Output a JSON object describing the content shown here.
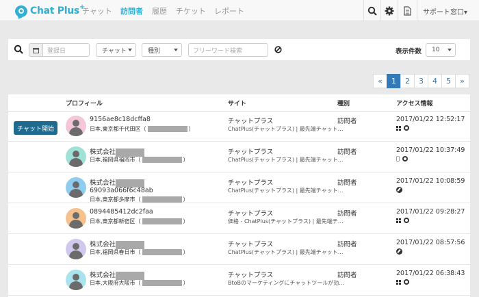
{
  "nav": {
    "logo_text": "Chat Plus",
    "logo_plus": "+",
    "menu": [
      {
        "label": "チャット",
        "active": false
      },
      {
        "label": "訪問者",
        "active": true
      },
      {
        "label": "履歴",
        "active": false
      },
      {
        "label": "チケット",
        "active": false
      },
      {
        "label": "レポート",
        "active": false
      }
    ],
    "user_menu": "サポート窓口▾"
  },
  "toolbar": {
    "date_placeholder": "登録日",
    "channel_select": "チャット",
    "type_select": "種別",
    "keyword_placeholder": "フリーワード検索",
    "page_size_label": "表示件数",
    "page_size_value": "10"
  },
  "pagination": {
    "pages": [
      "«",
      "1",
      "2",
      "3",
      "4",
      "5",
      "»"
    ],
    "active": "1"
  },
  "table": {
    "headers": {
      "profile": "プロフィール",
      "site": "サイト",
      "type": "種別",
      "access": "アクセス情報"
    },
    "chat_button": "チャット開始",
    "rows": [
      {
        "name": "9156ae8c18dcffa8",
        "name_masked": false,
        "extra": "",
        "location": "日本,東京都千代田区（",
        "location_end": "）",
        "site": "チャットプラス",
        "url": "ChatPlus(チャットプラス) | 最先端チャット…",
        "type": "訪問者",
        "date": "2017/01/22 12:52:17",
        "icons": [
          "windows",
          "chrome"
        ],
        "avatar_bg": "#f4c6d8"
      },
      {
        "name": "株式会社",
        "name_masked": true,
        "extra": "",
        "location": "日本,福岡県福岡市（",
        "location_end": "）",
        "site": "チャットプラス",
        "url": "ChatPlus(チャットプラス) | 最先端チャット…",
        "type": "訪問者",
        "date": "2017/01/22 10:37:49",
        "icons": [
          "apple",
          "chrome"
        ],
        "avatar_bg": "#9fe3d6"
      },
      {
        "name": "株式会社",
        "name_masked": true,
        "extra": "69093a066f6c48ab",
        "location": "日本,東京都多摩市（",
        "location_end": "）",
        "site": "チャットプラス",
        "url": "ChatPlus(チャットプラス) | 最先端チャット…",
        "type": "訪問者",
        "date": "2017/01/22 10:08:59",
        "icons": [
          "safari"
        ],
        "avatar_bg": "#8fcdf0"
      },
      {
        "name": "0894485412dc2faa",
        "name_masked": false,
        "extra": "",
        "location": "日本,東京都新宿区（",
        "location_end": "）",
        "site": "チャットプラス",
        "url": "価格 - ChatPlus(チャットプラス) | 最先端チ…",
        "type": "訪問者",
        "date": "2017/01/22 09:28:27",
        "icons": [
          "windows",
          "chrome"
        ],
        "avatar_bg": "#f6c18d"
      },
      {
        "name": "株式会社",
        "name_masked": true,
        "extra": "",
        "location": "日本,福岡県春日市（",
        "location_end": "）",
        "site": "チャットプラス",
        "url": "ChatPlus(チャットプラス) | 最先端チャット…",
        "type": "訪問者",
        "date": "2017/01/22 08:57:56",
        "icons": [
          "safari"
        ],
        "avatar_bg": "#d2c8ee"
      },
      {
        "name": "株式会社",
        "name_masked": true,
        "extra": "",
        "location": "日本,大阪府大阪市（",
        "location_end": "）",
        "site": "チャットプラス",
        "url": "BtoBのマーケティングにチャットツールが効…",
        "type": "訪問者",
        "date": "2017/01/22 06:38:43",
        "icons": [
          "windows",
          "chrome"
        ],
        "avatar_bg": "#a8e3ee"
      }
    ]
  },
  "colors": {
    "brand": "#31b0d5",
    "primary": "#337ab7",
    "chat_button": "#1f6a8e"
  }
}
